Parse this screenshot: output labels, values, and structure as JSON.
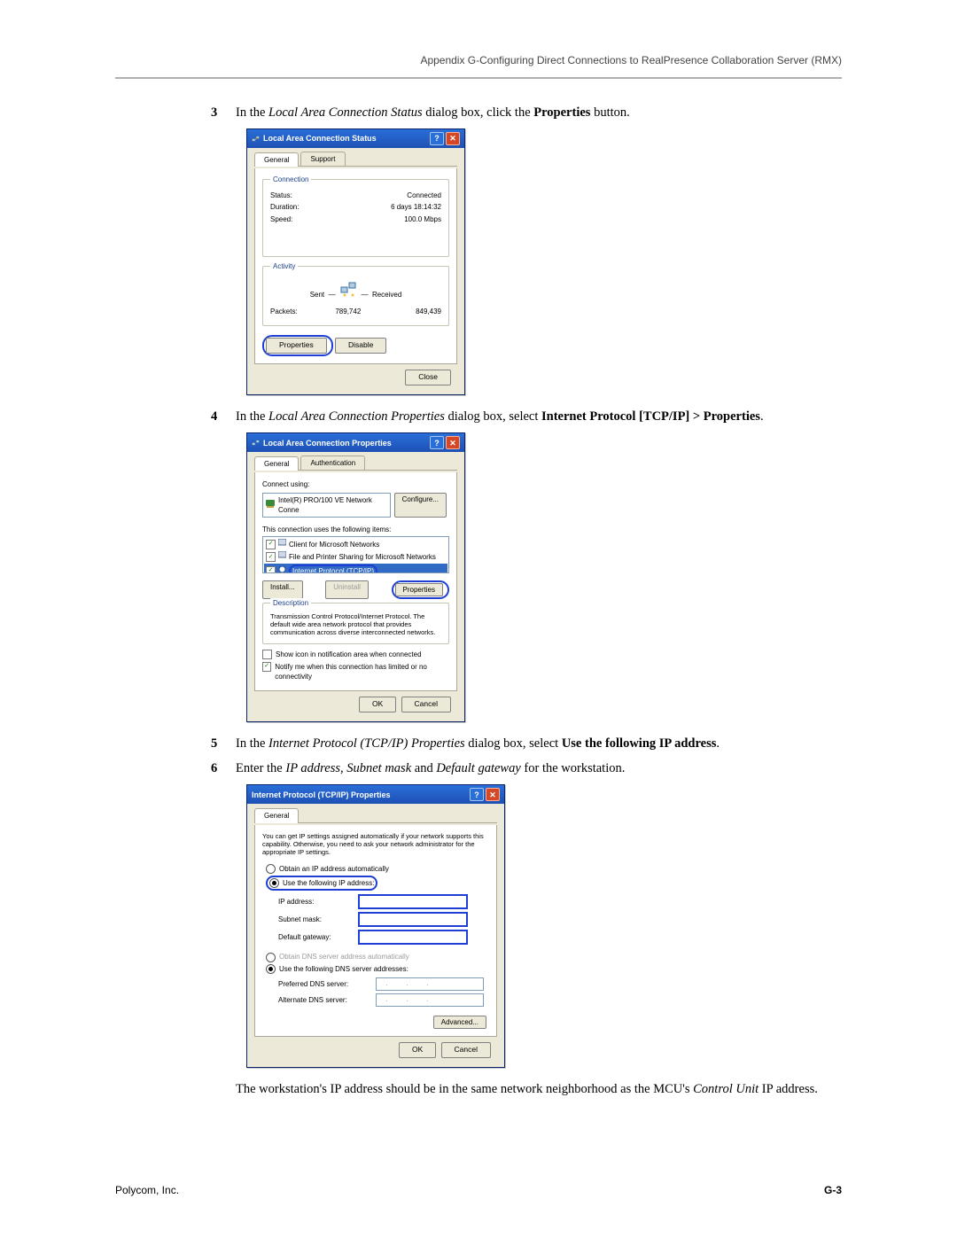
{
  "header": "Appendix G-Configuring Direct Connections to RealPresence Collaboration Server (RMX)",
  "steps": {
    "s3": {
      "num": "3",
      "pre": "In the ",
      "i1": "Local Area Connection Status",
      "mid": " dialog box, click the ",
      "b1": "Properties",
      "post": " button."
    },
    "s4": {
      "num": "4",
      "pre": "In the ",
      "i1": "Local Area Connection Properties",
      "mid": " dialog box, select ",
      "b1": "Internet Protocol [TCP/IP] > Properties",
      "post": "."
    },
    "s5": {
      "num": "5",
      "pre": "In the ",
      "i1": "Internet Protocol (TCP/IP) Properties",
      "mid": " dialog box, select ",
      "b1": "Use the following IP address",
      "post": "."
    },
    "s6": {
      "num": "6",
      "pre": "Enter the ",
      "i1": "IP address, Subnet mask",
      "mid": " and ",
      "i2": "Default gateway",
      "post": " for the workstation."
    }
  },
  "note": {
    "pre": "The workstation's IP address should be in the same network neighborhood as the MCU's ",
    "i1": "Control Unit",
    "post": " IP address."
  },
  "dialog1": {
    "title": "Local Area Connection Status",
    "tabs": {
      "general": "General",
      "support": "Support"
    },
    "grp_connection": "Connection",
    "status_l": "Status:",
    "status_r": "Connected",
    "duration_l": "Duration:",
    "duration_r": "6 days 18:14:32",
    "speed_l": "Speed:",
    "speed_r": "100.0 Mbps",
    "grp_activity": "Activity",
    "sent": "Sent",
    "received": "Received",
    "packets_l": "Packets:",
    "packets_sent": "789,742",
    "packets_recv": "849,439",
    "btn_properties": "Properties",
    "btn_disable": "Disable",
    "btn_close": "Close"
  },
  "dialog2": {
    "title": "Local Area Connection Properties",
    "tabs": {
      "general": "General",
      "auth": "Authentication"
    },
    "connect_using": "Connect using:",
    "nic": "Intel(R) PRO/100 VE Network Conne",
    "btn_configure": "Configure...",
    "items_label": "This connection uses the following items:",
    "item1": "Client for Microsoft Networks",
    "item2": "File and Printer Sharing for Microsoft Networks",
    "item3": "Internet Protocol (TCP/IP)",
    "btn_install": "Install...",
    "btn_uninstall": "Uninstall",
    "btn_properties": "Properties",
    "grp_desc": "Description",
    "desc_text": "Transmission Control Protocol/Internet Protocol. The default wide area network protocol that provides communication across diverse interconnected networks.",
    "cb1": "Show icon in notification area when connected",
    "cb2": "Notify me when this connection has limited or no connectivity",
    "btn_ok": "OK",
    "btn_cancel": "Cancel"
  },
  "dialog3": {
    "title": "Internet Protocol (TCP/IP) Properties",
    "tabs": {
      "general": "General"
    },
    "intro": "You can get IP settings assigned automatically if your network supports this capability. Otherwise, you need to ask your network administrator for the appropriate IP settings.",
    "r1": "Obtain an IP address automatically",
    "r2": "Use the following IP address:",
    "ip_l": "IP address:",
    "mask_l": "Subnet mask:",
    "gw_l": "Default gateway:",
    "r3": "Obtain DNS server address automatically",
    "r4": "Use the following DNS server addresses:",
    "dns1_l": "Preferred DNS server:",
    "dns2_l": "Alternate DNS server:",
    "btn_adv": "Advanced...",
    "btn_ok": "OK",
    "btn_cancel": "Cancel"
  },
  "footer": {
    "left": "Polycom, Inc.",
    "right": "G-3"
  }
}
